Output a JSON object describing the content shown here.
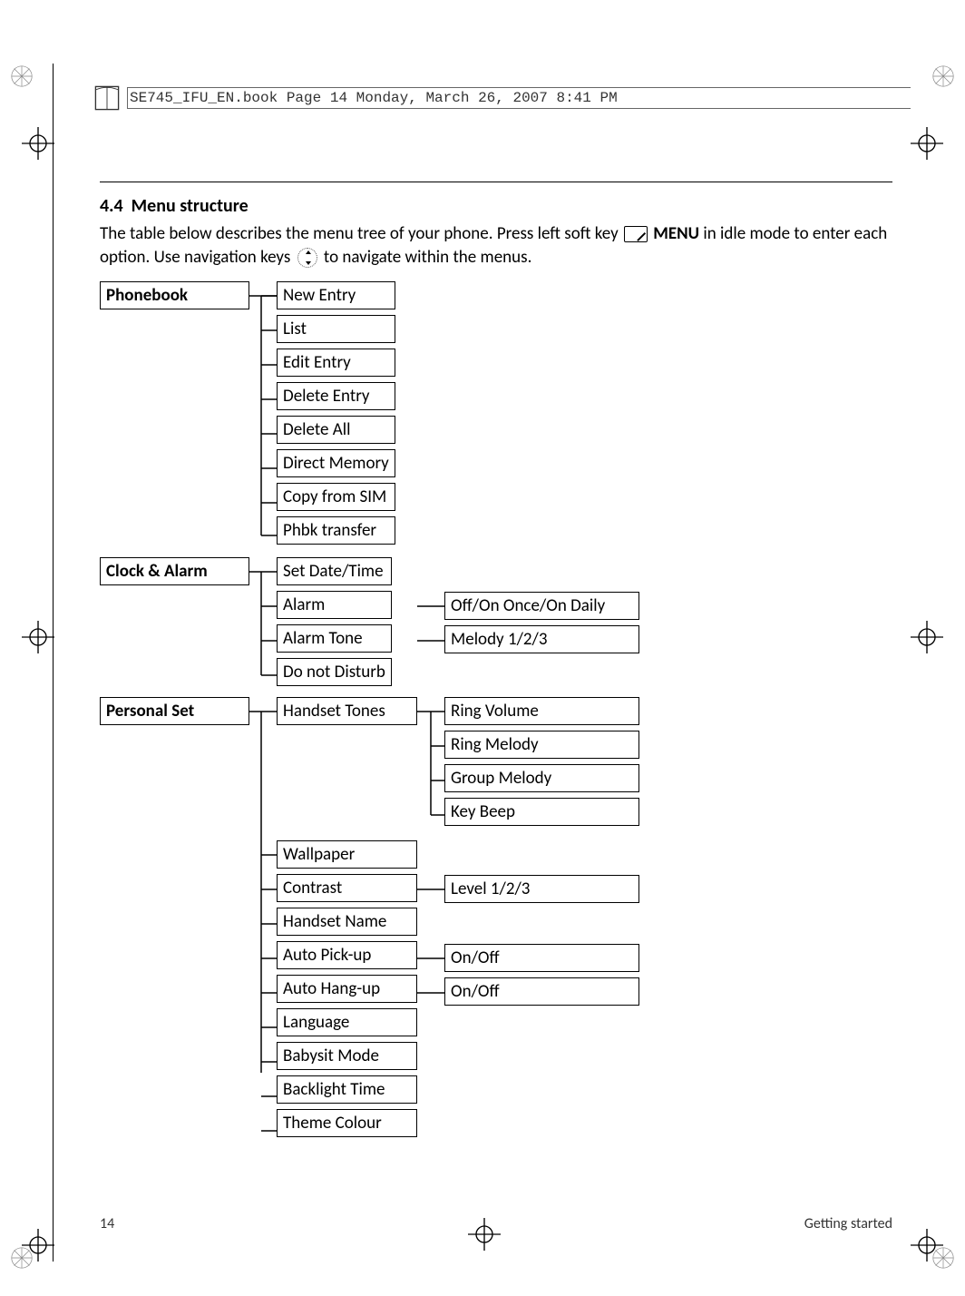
{
  "header": {
    "filename_line": "SE745_IFU_EN.book  Page 14  Monday, March 26, 2007  8:41 PM"
  },
  "section": {
    "number": "4.4",
    "title": "Menu structure",
    "intro_part1": "The table below describes the menu tree of your phone. Press left soft key ",
    "intro_menu": "MENU",
    "intro_part2": " in idle mode to enter each option. Use navigation keys ",
    "intro_part3": " to navigate within the menus."
  },
  "tree": {
    "phonebook": {
      "label": "Phonebook",
      "items": [
        "New Entry",
        "List",
        "Edit Entry",
        "Delete Entry",
        "Delete All",
        "Direct Memory",
        "Copy from SIM",
        "Phbk transfer"
      ]
    },
    "clock_alarm": {
      "label": "Clock & Alarm",
      "items": [
        {
          "label": "Set Date/Time"
        },
        {
          "label": "Alarm",
          "sub": "Off/On Once/On Daily"
        },
        {
          "label": "Alarm Tone",
          "sub": "Melody 1/2/3"
        },
        {
          "label": "Do not Disturb"
        }
      ]
    },
    "personal_set": {
      "label": "Personal Set",
      "items": [
        {
          "label": "Handset Tones",
          "subs": [
            "Ring Volume",
            "Ring Melody",
            "Group Melody",
            "Key Beep"
          ]
        },
        {
          "label": "Wallpaper"
        },
        {
          "label": "Contrast",
          "sub": "Level 1/2/3"
        },
        {
          "label": "Handset Name"
        },
        {
          "label": "Auto Pick-up",
          "sub": "On/Off"
        },
        {
          "label": "Auto Hang-up",
          "sub": "On/Off"
        },
        {
          "label": "Language"
        },
        {
          "label": "Babysit Mode"
        },
        {
          "label": "Backlight Time"
        },
        {
          "label": "Theme Colour"
        }
      ]
    }
  },
  "footer": {
    "page_number": "14",
    "section_name": "Getting started"
  }
}
